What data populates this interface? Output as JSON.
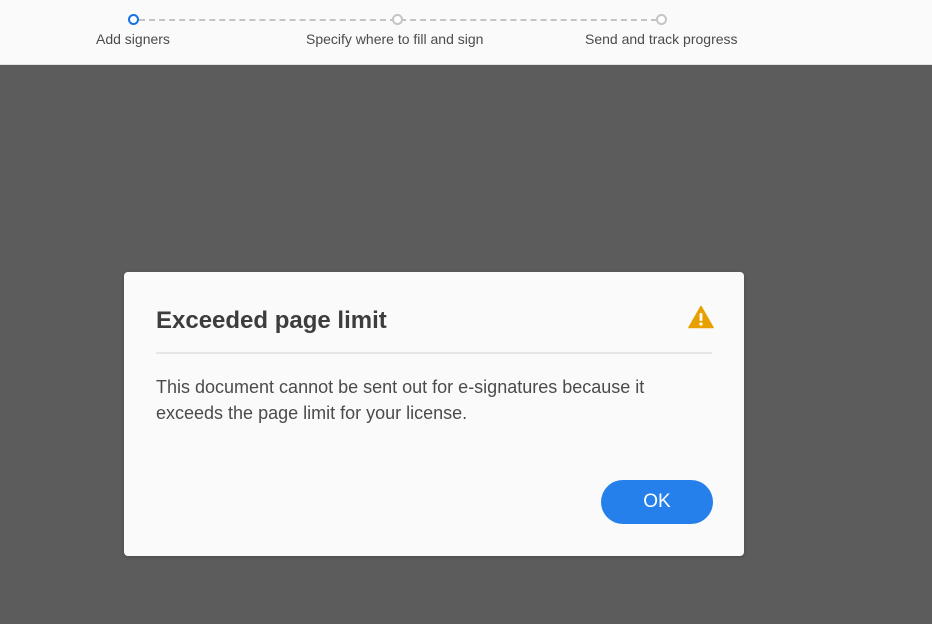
{
  "progress": {
    "steps": [
      {
        "label": "Add signers",
        "state": "active"
      },
      {
        "label": "Specify where to fill and sign",
        "state": "pending"
      },
      {
        "label": "Send and track progress",
        "state": "pending"
      }
    ]
  },
  "dialog": {
    "title": "Exceeded page limit",
    "message": "This document cannot be sent out for e-signatures because it exceeds the page limit for your license.",
    "ok_label": "OK",
    "icon": "alert-triangle-icon"
  },
  "colors": {
    "accent": "#2680eb",
    "active_step": "#1473e6",
    "warning": "#e8a000",
    "backdrop": "#5c5c5c"
  }
}
